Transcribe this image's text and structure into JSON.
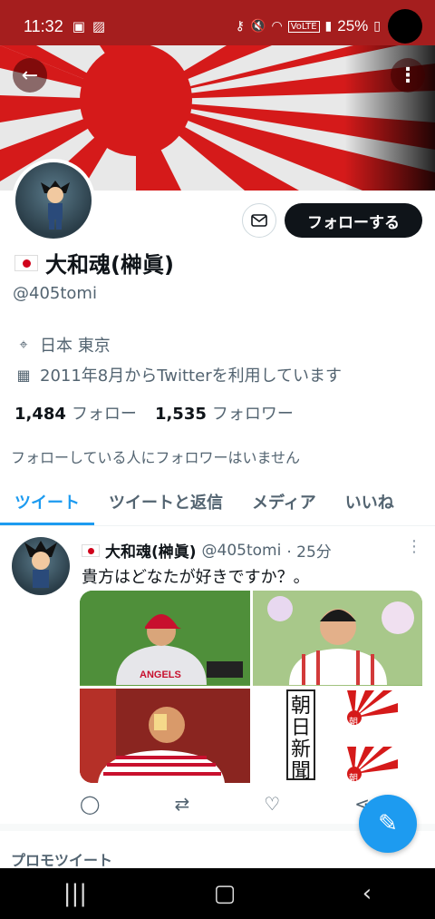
{
  "status": {
    "time": "11:32",
    "battery": "25%",
    "left_icons": [
      "tv-icon",
      "image-icon"
    ],
    "right_icons": [
      "key-icon",
      "mute-icon",
      "wifi-icon",
      "volte-icon",
      "signal-icon"
    ]
  },
  "profile": {
    "name": "大和魂(榊眞)",
    "handle": "@405tomi",
    "location": "日本 東京",
    "joined": "2011年8月からTwitterを利用しています",
    "following_count": "1,484",
    "following_label": "フォロー",
    "followers_count": "1,535",
    "followers_label": "フォロワー",
    "no_mutual": "フォローしている人にフォロワーはいません",
    "follow_button": "フォローする"
  },
  "tabs": [
    {
      "label": "ツイート",
      "active": true
    },
    {
      "label": "ツイートと返信",
      "active": false
    },
    {
      "label": "メディア",
      "active": false
    },
    {
      "label": "いいね",
      "active": false
    }
  ],
  "tweet": {
    "name": "大和魂(榊眞)",
    "handle": "@405tomi",
    "time": "· 25分",
    "text": "貴方はどなたが好きですか？。",
    "image_labels": {
      "angels": "ANGELS",
      "asahi_vertical": [
        "朝",
        "日",
        "新",
        "聞"
      ],
      "asahi_flag": "朝"
    }
  },
  "promo_label": "プロモツイート",
  "colors": {
    "accent": "#1d9bf0",
    "status_bar": "#a51e1e",
    "flag_red": "#d0021b"
  }
}
